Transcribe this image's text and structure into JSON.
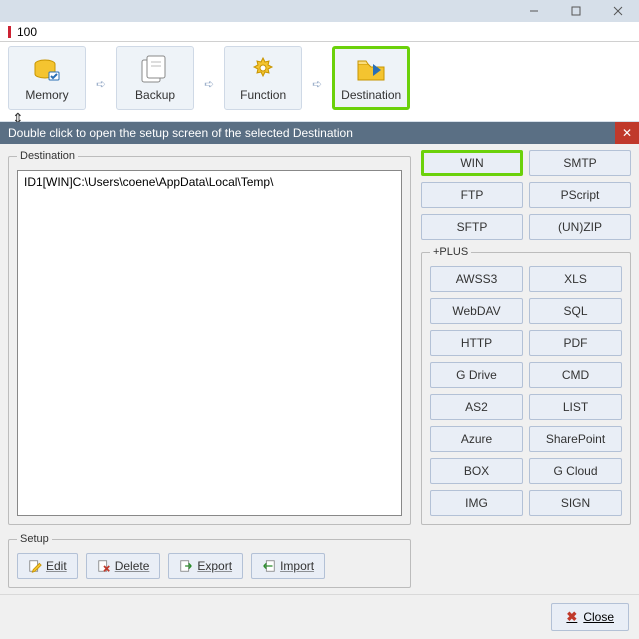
{
  "window": {
    "ribbon_value": "100"
  },
  "toolbar": {
    "memory": "Memory",
    "backup": "Backup",
    "function": "Function",
    "destination": "Destination"
  },
  "hint": "Double click to open the setup screen of the selected Destination",
  "destination": {
    "legend": "Destination",
    "item0": "ID1[WIN]C:\\Users\\coene\\AppData\\Local\\Temp\\"
  },
  "setup": {
    "legend": "Setup",
    "edit": "Edit",
    "delete": "Delete",
    "export": "Export",
    "import": "Import"
  },
  "cats": {
    "win": "WIN",
    "smtp": "SMTP",
    "ftp": "FTP",
    "pscript": "PScript",
    "sftp": "SFTP",
    "unzip": "(UN)ZIP"
  },
  "plus": {
    "legend": "+PLUS",
    "awss3": "AWSS3",
    "xls": "XLS",
    "webdav": "WebDAV",
    "sql": "SQL",
    "http": "HTTP",
    "pdf": "PDF",
    "gdrive": "G Drive",
    "cmd": "CMD",
    "as2": "AS2",
    "list": "LIST",
    "azure": "Azure",
    "sharepoint": "SharePoint",
    "box": "BOX",
    "gcloud": "G Cloud",
    "img": "IMG",
    "sign": "SIGN"
  },
  "footer": {
    "close": "Close"
  }
}
